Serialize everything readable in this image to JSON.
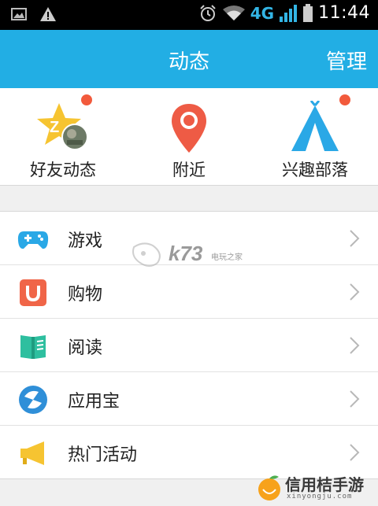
{
  "status_bar": {
    "network": "4G",
    "time": "11:44"
  },
  "header": {
    "title": "动态",
    "manage_label": "管理"
  },
  "quick_entries": [
    {
      "label": "好友动态",
      "icon": "friends-feed-icon",
      "badge": true
    },
    {
      "label": "附近",
      "icon": "location-pin-icon",
      "badge": false
    },
    {
      "label": "兴趣部落",
      "icon": "tent-icon",
      "badge": true
    }
  ],
  "list_items": [
    {
      "label": "游戏",
      "icon": "gamepad-icon"
    },
    {
      "label": "购物",
      "icon": "shopping-bag-icon"
    },
    {
      "label": "阅读",
      "icon": "book-icon"
    },
    {
      "label": "应用宝",
      "icon": "app-store-icon"
    },
    {
      "label": "热门活动",
      "icon": "megaphone-icon"
    }
  ],
  "watermarks": {
    "center": "k73",
    "center_sub": "电玩之家",
    "bottom_title": "信用桔手游",
    "bottom_url": "xinyongju.com"
  },
  "colors": {
    "header": "#22aee4",
    "badge": "#f25a3c",
    "pin": "#ee5b45",
    "tent": "#2aa8e6",
    "star": "#f6c431"
  }
}
